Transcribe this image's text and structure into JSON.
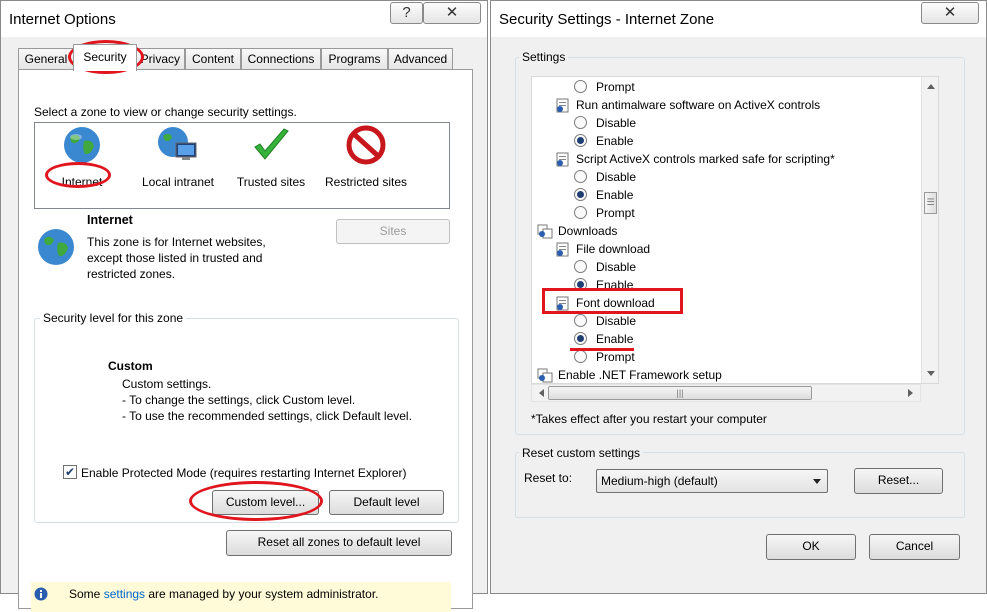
{
  "left_window": {
    "title": "Internet Options",
    "help_label": "?",
    "close_label": "✕",
    "tabs": [
      {
        "label": "General"
      },
      {
        "label": "Security"
      },
      {
        "label": "Privacy"
      },
      {
        "label": "Content"
      },
      {
        "label": "Connections"
      },
      {
        "label": "Programs"
      },
      {
        "label": "Advanced"
      }
    ],
    "zone_prompt": "Select a zone to view or change security settings.",
    "zones": [
      {
        "label": "Internet"
      },
      {
        "label": "Local intranet"
      },
      {
        "label": "Trusted sites"
      },
      {
        "label": "Restricted sites"
      }
    ],
    "zone_info": {
      "title": "Internet",
      "description": [
        "This zone is for Internet websites,",
        "except those listed in trusted and",
        "restricted zones."
      ],
      "sites_button": "Sites"
    },
    "security_level": {
      "legend": "Security level for this zone",
      "level_name": "Custom",
      "lines": [
        "Custom settings.",
        "- To change the settings, click Custom level.",
        "- To use the recommended settings, click Default level."
      ],
      "protected_mode_label": "Enable Protected Mode (requires restarting Internet Explorer)",
      "custom_level_button": "Custom level...",
      "default_level_button": "Default level"
    },
    "reset_all_button": "Reset all zones to default level",
    "admin_notice_prefix": "Some ",
    "admin_notice_link": "settings",
    "admin_notice_suffix": " are managed by your system administrator."
  },
  "right_window": {
    "title": "Security Settings - Internet Zone",
    "close_label": "✕",
    "settings_legend": "Settings",
    "tree": [
      {
        "type": "radio",
        "label": "Prompt",
        "checked": false
      },
      {
        "type": "item",
        "label": "Run antimalware software on ActiveX controls"
      },
      {
        "type": "radio",
        "label": "Disable",
        "checked": false
      },
      {
        "type": "radio",
        "label": "Enable",
        "checked": true
      },
      {
        "type": "item",
        "label": "Script ActiveX controls marked safe for scripting*"
      },
      {
        "type": "radio",
        "label": "Disable",
        "checked": false
      },
      {
        "type": "radio",
        "label": "Enable",
        "checked": true
      },
      {
        "type": "radio",
        "label": "Prompt",
        "checked": false
      },
      {
        "type": "category",
        "label": "Downloads"
      },
      {
        "type": "item",
        "label": "File download"
      },
      {
        "type": "radio",
        "label": "Disable",
        "checked": false
      },
      {
        "type": "radio",
        "label": "Enable",
        "checked": true
      },
      {
        "type": "item",
        "label": "Font download"
      },
      {
        "type": "radio",
        "label": "Disable",
        "checked": false
      },
      {
        "type": "radio",
        "label": "Enable",
        "checked": true
      },
      {
        "type": "radio",
        "label": "Prompt",
        "checked": false
      },
      {
        "type": "category",
        "label": "Enable .NET Framework setup"
      }
    ],
    "restart_note": "*Takes effect after you restart your computer",
    "reset_legend": "Reset custom settings",
    "reset_to_label": "Reset to:",
    "reset_to_value": "Medium-high (default)",
    "reset_button": "Reset...",
    "ok_button": "OK",
    "cancel_button": "Cancel"
  },
  "colors": {
    "annotation_red": "#e0151e",
    "link_blue": "#0066cc",
    "notice_yellow": "#fffbd8"
  }
}
